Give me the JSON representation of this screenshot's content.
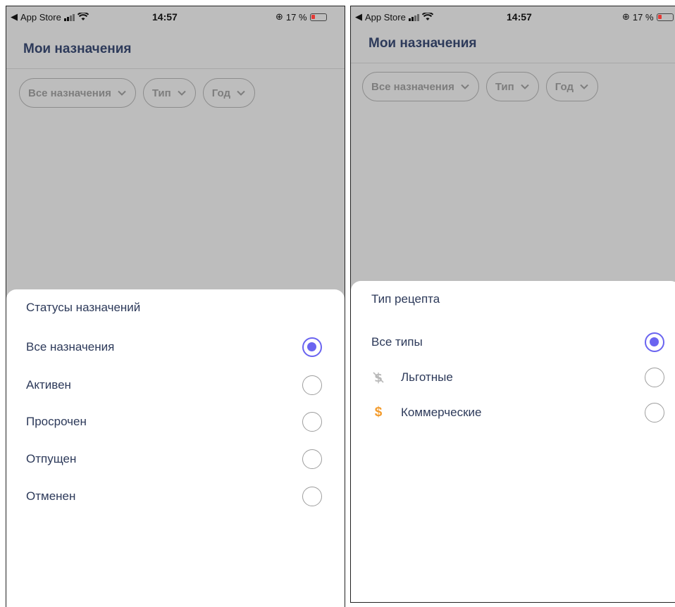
{
  "status_bar": {
    "back_app": "App Store",
    "time": "14:57",
    "battery": "17 %"
  },
  "header": {
    "title": "Мои назначения"
  },
  "filters": {
    "chips": [
      {
        "label": "Все назначения"
      },
      {
        "label": "Тип"
      },
      {
        "label": "Год"
      }
    ]
  },
  "left_sheet": {
    "title": "Статусы назначений",
    "options": [
      {
        "label": "Все назначения",
        "selected": true
      },
      {
        "label": "Активен",
        "selected": false
      },
      {
        "label": "Просрочен",
        "selected": false
      },
      {
        "label": "Отпущен",
        "selected": false
      },
      {
        "label": "Отменен",
        "selected": false
      }
    ]
  },
  "right_sheet": {
    "title": "Тип рецепта",
    "options": [
      {
        "label": "Все типы",
        "selected": true,
        "icon": ""
      },
      {
        "label": "Льготные",
        "selected": false,
        "icon": "crossed-dollar-icon"
      },
      {
        "label": "Коммерческие",
        "selected": false,
        "icon": "dollar-icon"
      }
    ]
  },
  "colors": {
    "accent": "#6a64f0",
    "text": "#2d3a5a",
    "overlay": "#bdbdbd",
    "dollar": "#f39b2c"
  }
}
